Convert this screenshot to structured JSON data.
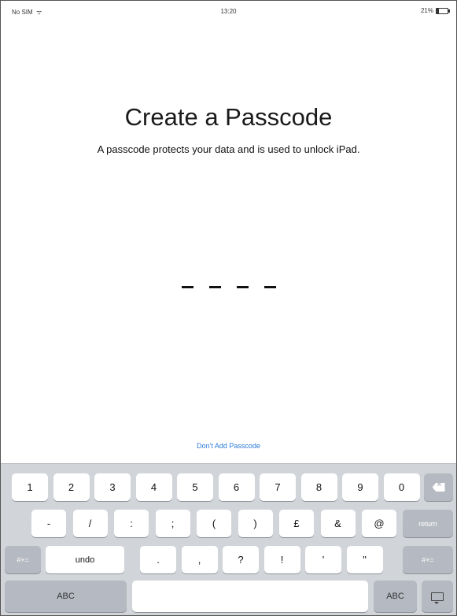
{
  "status_bar": {
    "carrier": "No SIM",
    "wifi_icon": "wifi-icon",
    "time": "13:20",
    "battery_percent_label": "21%",
    "battery_level": 0.21
  },
  "page": {
    "title": "Create a Passcode",
    "subtitle": "A passcode protects your data and is used to unlock iPad.",
    "passcode_length": 4,
    "skip_link": "Don't Add Passcode"
  },
  "keyboard": {
    "row1": [
      "1",
      "2",
      "3",
      "4",
      "5",
      "6",
      "7",
      "8",
      "9",
      "0"
    ],
    "row1_delete_icon": "delete-backspace-icon",
    "row2": [
      "-",
      "/",
      ":",
      ";",
      "(",
      ")",
      "£",
      "&",
      "@"
    ],
    "row2_return": "return",
    "row3_left_toggle": "#+=",
    "row3_undo": "undo",
    "row3": [
      ".",
      ",",
      "?",
      "!",
      "'",
      "\""
    ],
    "row3_right_toggle": "#+=",
    "row4_abc_left": "ABC",
    "row4_abc_right": "ABC",
    "row4_dismiss_icon": "keyboard-dismiss-icon",
    "colors": {
      "background": "#d1d4d9",
      "key": "#ffffff",
      "function_key": "#b5b9c1",
      "link": "#2a7ad6"
    }
  }
}
